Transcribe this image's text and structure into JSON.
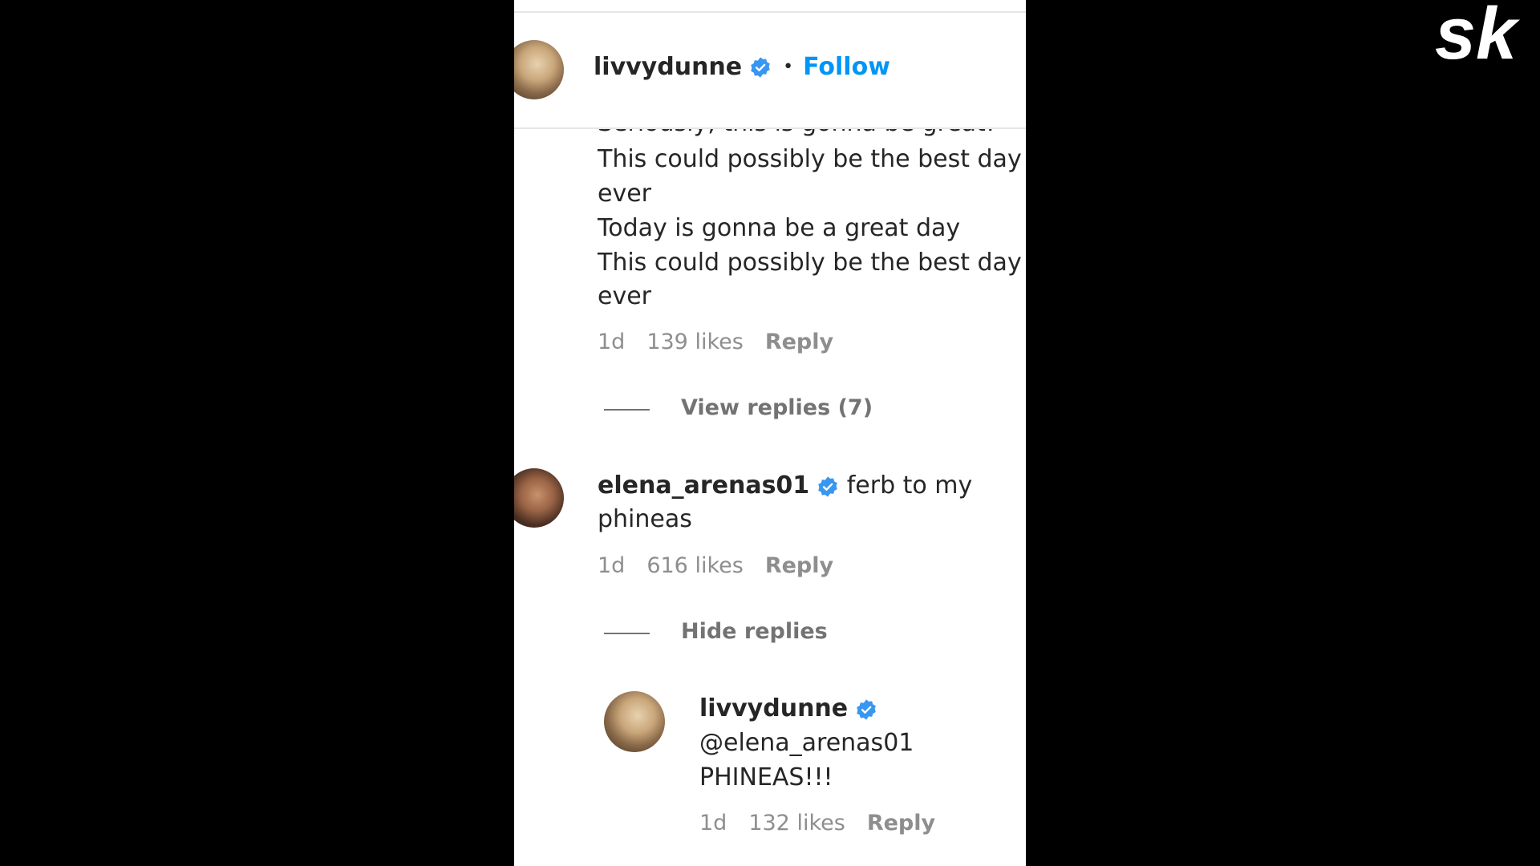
{
  "header": {
    "username": "livvydunne",
    "follow_label": "Follow"
  },
  "comment1": {
    "lines": [
      "Seriously, this is gonna be great!",
      "This could possibly be the best day",
      "ever",
      "Today is gonna be a great day",
      "This could possibly be the best day",
      "ever"
    ],
    "time": "1d",
    "likes": "139 likes",
    "reply_label": "Reply",
    "view_replies_label": "View replies (7)"
  },
  "comment2": {
    "username": "elena_arenas01",
    "text_line1": "ferb to my",
    "text_line2": "phineas",
    "time": "1d",
    "likes": "616 likes",
    "reply_label": "Reply",
    "hide_replies_label": "Hide replies"
  },
  "reply1": {
    "username": "livvydunne",
    "mention": "@elena_arenas01",
    "text": "PHINEAS!!!",
    "time": "1d",
    "likes": "132 likes",
    "reply_label": "Reply"
  },
  "colors": {
    "accent": "#0095f6",
    "verified": "#3897f0",
    "muted": "#8e8e8e"
  },
  "logo_text": "sk"
}
